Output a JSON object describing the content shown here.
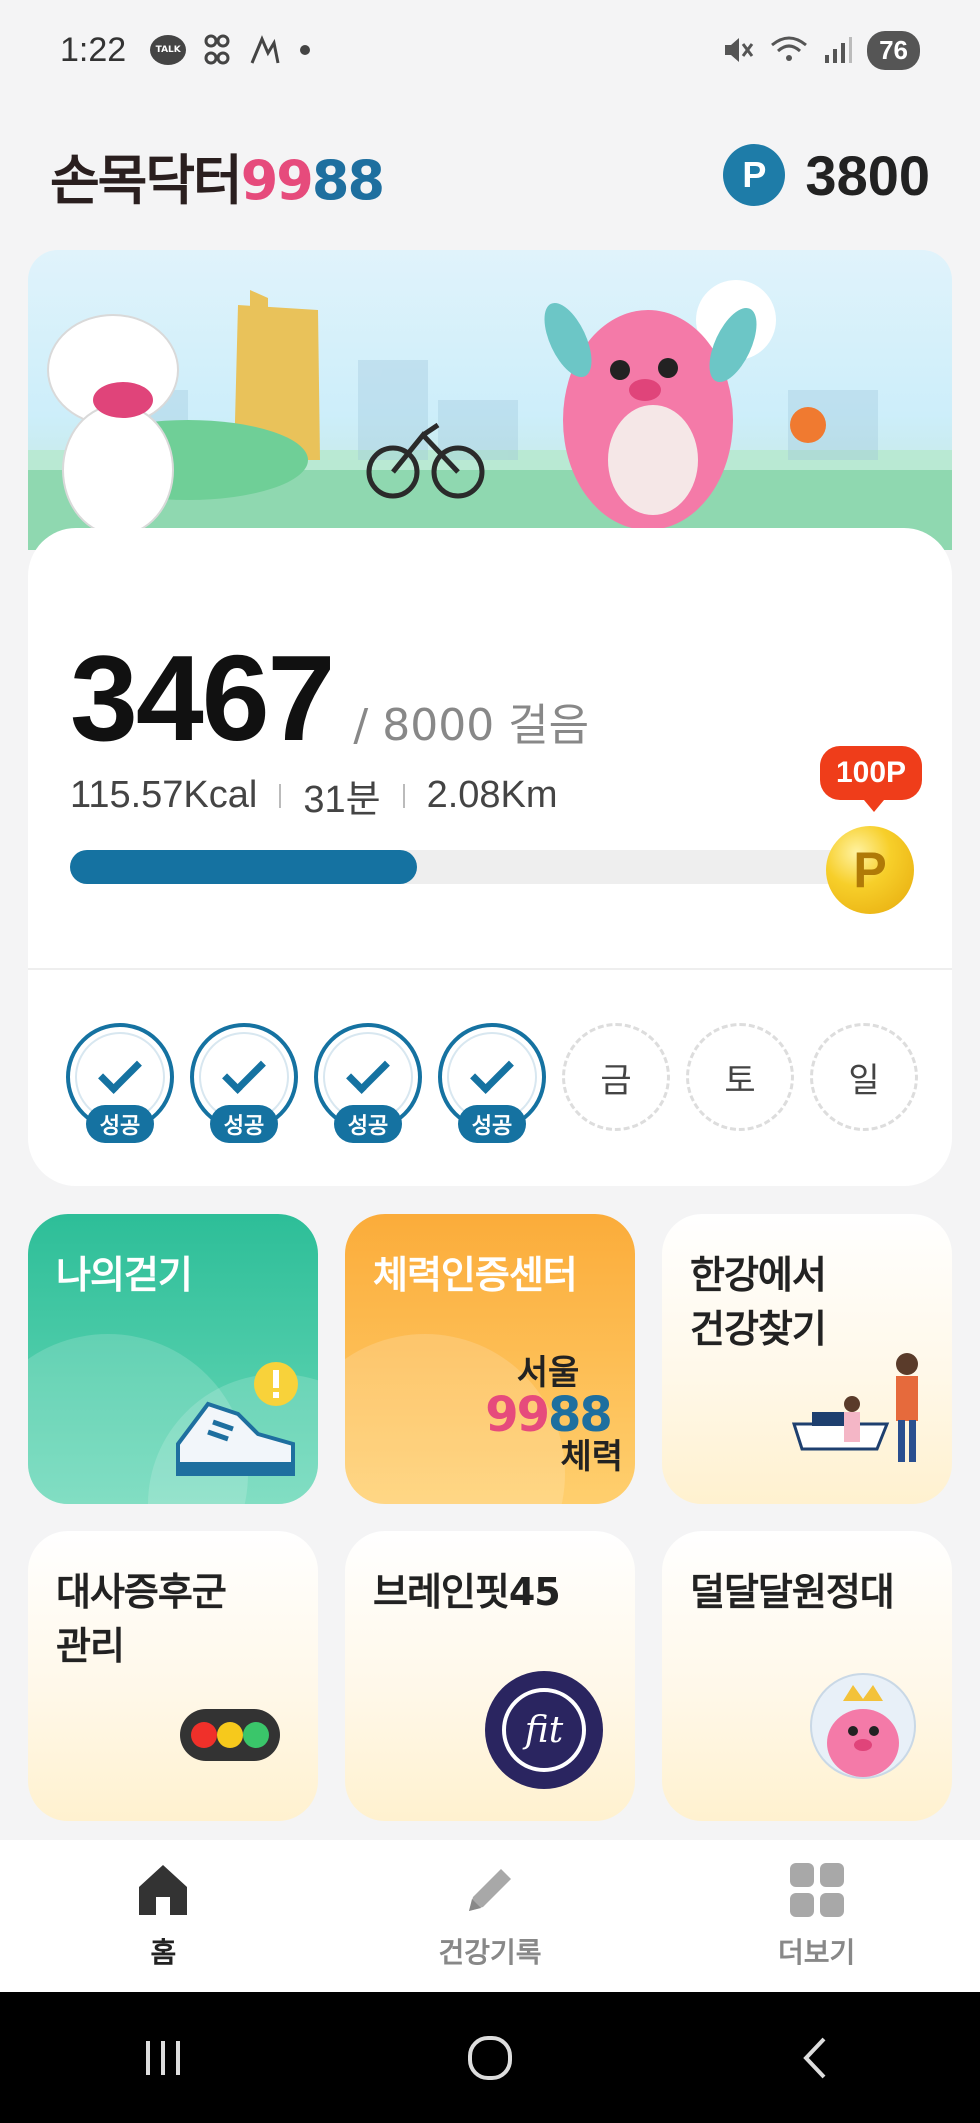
{
  "status_bar": {
    "time": "1:22",
    "talk_label": "TALK",
    "battery": "76"
  },
  "header": {
    "logo_ko": "손목닥터",
    "logo_num1": "99",
    "logo_num2": "88",
    "points_icon": "P",
    "points": "3800"
  },
  "steps": {
    "current": "3467",
    "goal_text": "/ 8000 걸음",
    "progress": 0.4334,
    "kcal": "115.57Kcal",
    "minutes": "31분",
    "distance": "2.08Km",
    "reward": "100P",
    "coin": "P"
  },
  "week": {
    "days": [
      {
        "label": "",
        "done": true,
        "badge": "성공"
      },
      {
        "label": "",
        "done": true,
        "badge": "성공"
      },
      {
        "label": "",
        "done": true,
        "badge": "성공"
      },
      {
        "label": "",
        "done": true,
        "badge": "성공"
      },
      {
        "label": "금",
        "done": false
      },
      {
        "label": "토",
        "done": false
      },
      {
        "label": "일",
        "done": false
      }
    ]
  },
  "tiles": {
    "my_walking": "나의걷기",
    "fitness_center": "체력인증센터",
    "fitness_logo_top": "서울",
    "fitness_logo_99": "99",
    "fitness_logo_88": "88",
    "fitness_logo_bottom": "체력",
    "hangang_line1": "한강에서",
    "hangang_line2": "건강찾기",
    "metabolic_line1": "대사증후군",
    "metabolic_line2": "관리",
    "brain_fit": "브레인핏45",
    "brain_fit_logo": "fit",
    "sugar_squad": "덜달달원정대"
  },
  "nav": {
    "home": "홈",
    "health_record": "건강기록",
    "more": "더보기"
  },
  "colors": {
    "accent": "#1572a1",
    "reward_red": "#ef3d1a",
    "green_tile": "#2dbe98",
    "orange_tile": "#fbac3a"
  }
}
